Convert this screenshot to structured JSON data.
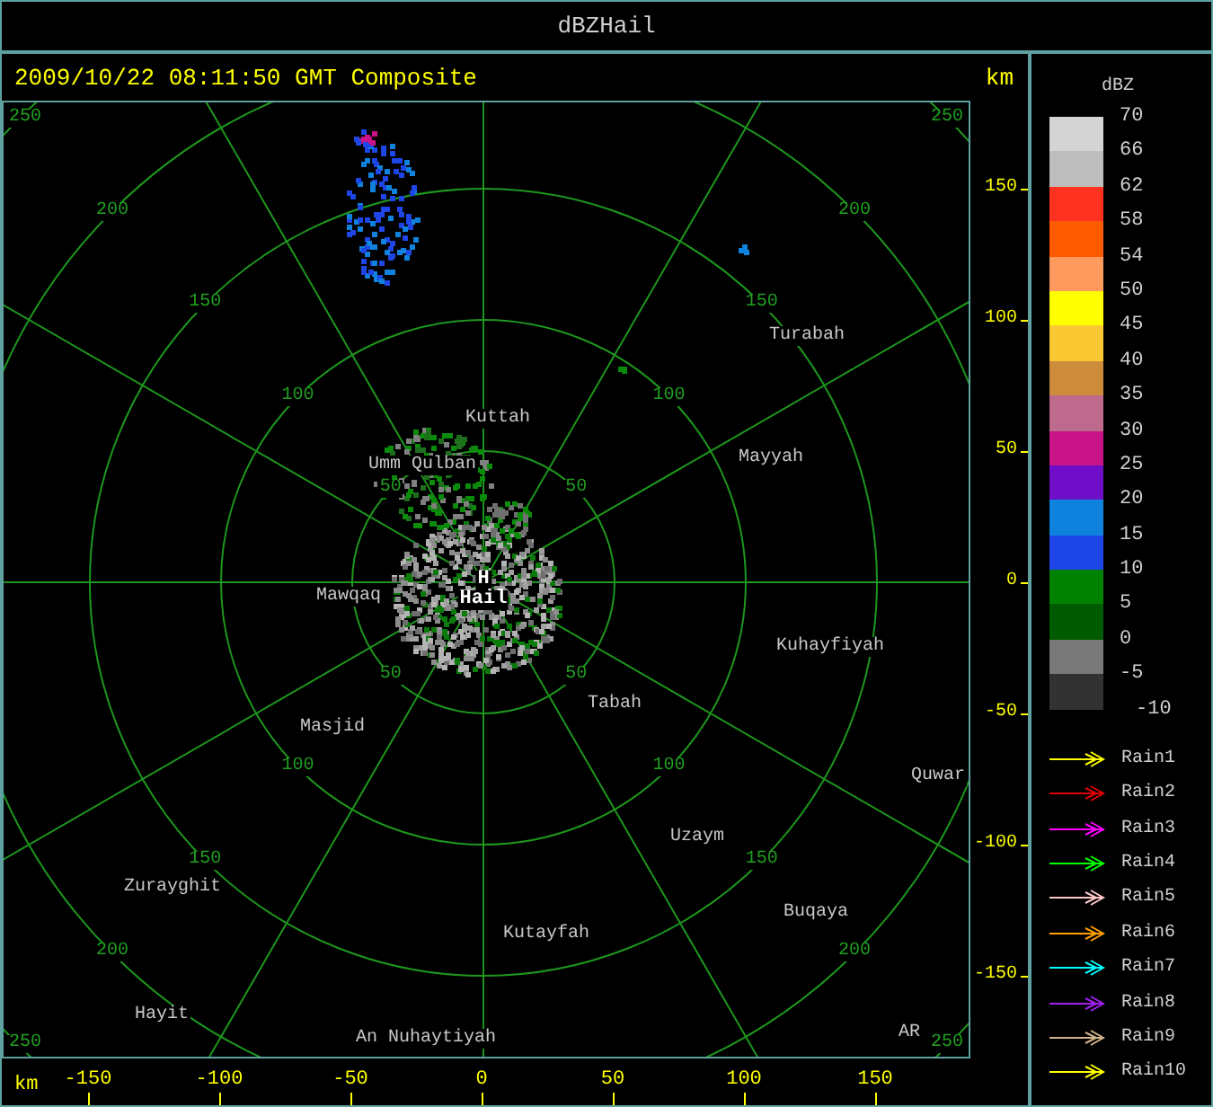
{
  "window": {
    "title": "dBZHail"
  },
  "header": {
    "timestamp": "2009/10/22 08:11:50 GMT Composite",
    "unit": "km"
  },
  "map": {
    "range_rings": [
      {
        "labels": [
          "50",
          "50",
          "50",
          "50"
        ]
      },
      {
        "labels": [
          "100",
          "100",
          "100",
          "100"
        ]
      },
      {
        "labels": [
          "150",
          "150",
          "150",
          "150"
        ]
      },
      {
        "labels": [
          "200",
          "200",
          "200",
          "200"
        ]
      },
      {
        "labels": [
          "250",
          "250",
          "250",
          "250"
        ]
      }
    ],
    "places": [
      {
        "name": "Turabah",
        "kind": "town"
      },
      {
        "name": "Kuttah",
        "kind": "town"
      },
      {
        "name": "Mayyah",
        "kind": "town"
      },
      {
        "name": "Umm Qulban",
        "kind": "town"
      },
      {
        "name": "H",
        "kind": "site"
      },
      {
        "name": "Mawqaq",
        "kind": "town"
      },
      {
        "name": "Hail",
        "kind": "site"
      },
      {
        "name": "Kuhayfiyah",
        "kind": "town"
      },
      {
        "name": "Tabah",
        "kind": "town"
      },
      {
        "name": "Masjid",
        "kind": "town"
      },
      {
        "name": "Quwar",
        "kind": "town"
      },
      {
        "name": "Uzaym",
        "kind": "town"
      },
      {
        "name": "Zurayghit",
        "kind": "town"
      },
      {
        "name": "Buqaya",
        "kind": "town"
      },
      {
        "name": "Kutayfah",
        "kind": "town"
      },
      {
        "name": "Hayit",
        "kind": "town"
      },
      {
        "name": "An Nuhaytiyah",
        "kind": "town"
      },
      {
        "name": "AR",
        "kind": "town"
      }
    ]
  },
  "right_axis": {
    "ticks": [
      "150",
      "100",
      "50",
      "0",
      "-50",
      "-100",
      "-150"
    ]
  },
  "bottom_axis": {
    "unit": "km",
    "ticks": [
      "-150",
      "-100",
      "-50",
      "0",
      "50",
      "100",
      "150"
    ]
  },
  "legend": {
    "title": "dBZ",
    "swatches": [
      {
        "label": "70",
        "color": "#d4d4d4"
      },
      {
        "label": "66",
        "color": "#bebebe"
      },
      {
        "label": "62",
        "color": "#ff3222"
      },
      {
        "label": "58",
        "color": "#ff5a00"
      },
      {
        "label": "54",
        "color": "#ff9a5e"
      },
      {
        "label": "50",
        "color": "#ffff00"
      },
      {
        "label": "45",
        "color": "#fac832"
      },
      {
        "label": "40",
        "color": "#cd8c3c"
      },
      {
        "label": "35",
        "color": "#be6a8c"
      },
      {
        "label": "30",
        "color": "#c81488"
      },
      {
        "label": "25",
        "color": "#6e0ec8"
      },
      {
        "label": "20",
        "color": "#0e82dc"
      },
      {
        "label": "15",
        "color": "#1e46e6"
      },
      {
        "label": "10",
        "color": "#008200"
      },
      {
        "label": "5",
        "color": "#005a00"
      },
      {
        "label": "0",
        "color": "#787878"
      },
      {
        "label": "-5",
        "color": "#323232"
      }
    ],
    "bottom_label": "-10",
    "tracks": [
      {
        "label": "Rain1",
        "color": "#ffff00"
      },
      {
        "label": "Rain2",
        "color": "#e00000"
      },
      {
        "label": "Rain3",
        "color": "#ff00ff"
      },
      {
        "label": "Rain4",
        "color": "#00ff00"
      },
      {
        "label": "Rain5",
        "color": "#ffc8c8"
      },
      {
        "label": "Rain6",
        "color": "#ffa000"
      },
      {
        "label": "Rain7",
        "color": "#00ffff"
      },
      {
        "label": "Rain8",
        "color": "#a020f0"
      },
      {
        "label": "Rain9",
        "color": "#d2b48c"
      },
      {
        "label": "Rain10",
        "color": "#ffff00"
      }
    ]
  }
}
